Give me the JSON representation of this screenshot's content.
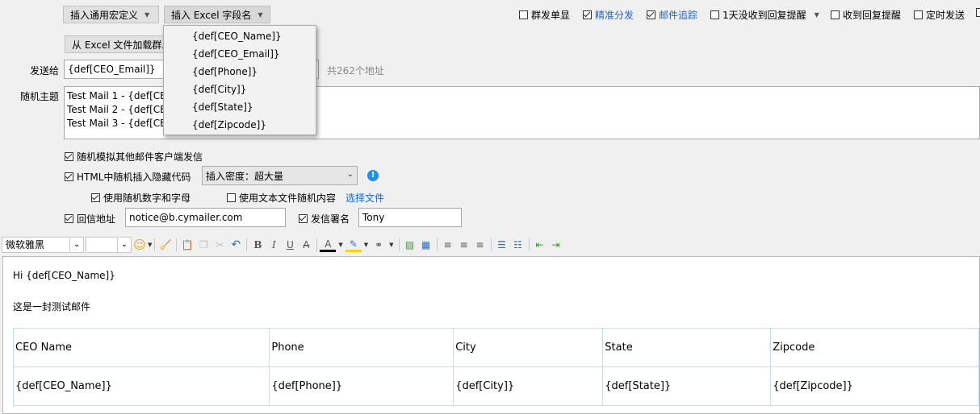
{
  "top_buttons": {
    "macro_label": "插入通用宏定义",
    "excel_label": "插入 Excel 字段名"
  },
  "options": [
    {
      "label": "群发单显",
      "checked": false,
      "highlight": false
    },
    {
      "label": "精准分发",
      "checked": true,
      "highlight": true
    },
    {
      "label": "邮件追踪",
      "checked": true,
      "highlight": true
    },
    {
      "label": "1天没收到回复提醒",
      "checked": false,
      "highlight": false
    },
    {
      "label": "收到回复提醒",
      "checked": false,
      "highlight": false
    },
    {
      "label": "定时发送",
      "checked": false,
      "highlight": false
    }
  ],
  "load_button": "从 Excel 文件加载群发",
  "send_to": {
    "label": "发送给",
    "value": "{def[CEO_Email]}",
    "count_text": "共262个地址"
  },
  "subject": {
    "label": "随机主题",
    "lines": [
      "Test Mail 1 - {def[CE",
      "Test Mail 2 - {def[CE",
      "Test Mail 3 - {def[CE"
    ]
  },
  "dropdown_items": [
    "{def[CEO_Name]}",
    "{def[CEO_Email]}",
    "{def[Phone]}",
    "{def[City]}",
    "{def[State]}",
    "{def[Zipcode]}"
  ],
  "settings": {
    "simulate_client": "随机模拟其他邮件客户端发信",
    "html_hidden": "HTML中随机插入隐藏代码",
    "density_value": "插入密度：超大量",
    "random_alnum": "使用随机数字和字母",
    "random_text": "使用文本文件随机内容",
    "choose_file": "选择文件",
    "reply_label": "回信地址",
    "reply_value": "notice@b.cymailer.com",
    "sender_label": "发信署名",
    "sender_value": "Tony"
  },
  "font_select": "微软雅黑",
  "body": {
    "greeting": "Hi {def[CEO_Name]}",
    "line": "这是一封测试邮件",
    "table_headers": [
      "CEO Name",
      "Phone",
      "City",
      "State",
      "Zipcode"
    ],
    "table_values": [
      "{def[CEO_Name]}",
      "{def[Phone]}",
      "{def[City]}",
      "{def[State]}",
      "{def[Zipcode]}"
    ]
  },
  "colors": {
    "accent": "#1a66c9",
    "info_icon": "#1e90ff",
    "table_border": "#c6daf0"
  }
}
